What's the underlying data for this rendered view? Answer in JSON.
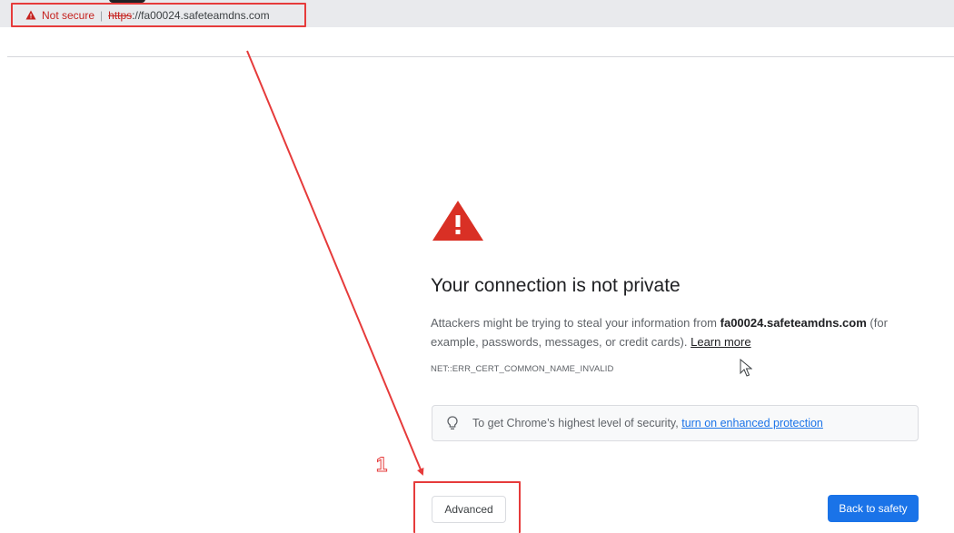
{
  "address_bar": {
    "security_label": "Not secure",
    "separator": "|",
    "url_scheme": "https",
    "url_rest": "://fa00024.safeteamdns.com",
    "warning_icon": "warning-triangle-icon"
  },
  "interstitial": {
    "warning_icon": "warning-triangle-icon",
    "heading": "Your connection is not private",
    "body_prefix": "Attackers might be trying to steal your information from ",
    "body_domain": "fa00024.safeteamdns.com",
    "body_suffix": " (for example, passwords, messages, or credit cards). ",
    "learn_more": "Learn more",
    "error_code": "NET::ERR_CERT_COMMON_NAME_INVALID",
    "tip_icon": "lightbulb-icon",
    "tip_prefix": "To get Chrome’s highest level of security, ",
    "tip_link": "turn on enhanced protection",
    "advanced_button": "Advanced",
    "back_button": "Back to safety"
  },
  "annotation": {
    "step_number": "1",
    "color": "#e63b3b"
  },
  "colors": {
    "warning_red": "#d93025",
    "accent_blue": "#1a73e8",
    "text_dark": "#202124",
    "text_muted": "#5f6368"
  }
}
